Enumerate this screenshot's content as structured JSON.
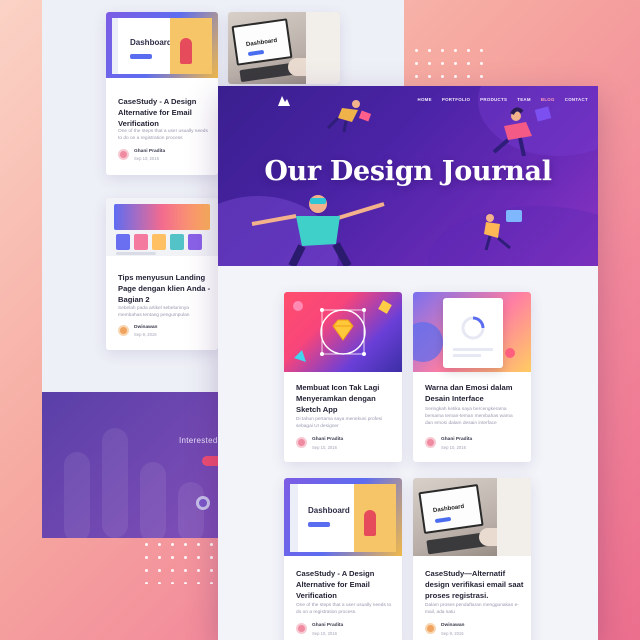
{
  "back_cards": [
    {
      "title": "CaseStudy - A Design Alternative for Email Verification",
      "desc": "One of the steps that a user usually needs to do on a registration process",
      "author": "Ghani Pradita",
      "date": "Sep 10, 2016",
      "thumb_text": "Dashboard"
    },
    {
      "title": "Tips menyusun Landing Page dengan klien Anda - Bagian 2",
      "desc": "Sebelah pada artikel sebelumnya membahas tentang pengumpulan",
      "author": "Dwinawan",
      "date": "Sep 9, 2016"
    }
  ],
  "back_laptop_thumb_text": "Dashboard",
  "back_cta_text": "Interested t",
  "nav": {
    "items": [
      "HOME",
      "PORTFOLIO",
      "PRODUCTS",
      "TEAM",
      "BLOG",
      "CONTACT"
    ]
  },
  "hero": {
    "title": "Our Design Journal"
  },
  "cards": [
    {
      "title": "Membuat Icon Tak Lagi Menyeramkan dengan Sketch App",
      "desc": "Di tahun pertama saya menekuni profesi sebagai UI designer",
      "author": "Ghani Pradita",
      "date": "Sep 10, 2016"
    },
    {
      "title": "Warna dan Emosi dalam Desain Interface",
      "desc": "Seringkah ketika saya bercengkerama bersama teman-teman membahas warna dan emosi dalam desain interface",
      "author": "Ghani Pradita",
      "date": "Sep 10, 2016"
    },
    {
      "title": "CaseStudy - A Design Alternative for Email Verification",
      "desc": "One of the steps that a user usually needs to do on a registration process.",
      "author": "Ghani Pradita",
      "date": "Sep 10, 2016",
      "thumb_text": "Dashboard"
    },
    {
      "title": "CaseStudy—Alternatif design verifikasi email saat proses registrasi.",
      "desc": "Dalam proses pendaftaran menggunakan e-mail, ada satu",
      "author": "Dwinawan",
      "date": "Sep 9, 2016",
      "thumb_text": "Dashboard"
    }
  ],
  "colors": {
    "accent": "#ef4e73",
    "hero": "#4a23a5",
    "title": "#232336"
  }
}
